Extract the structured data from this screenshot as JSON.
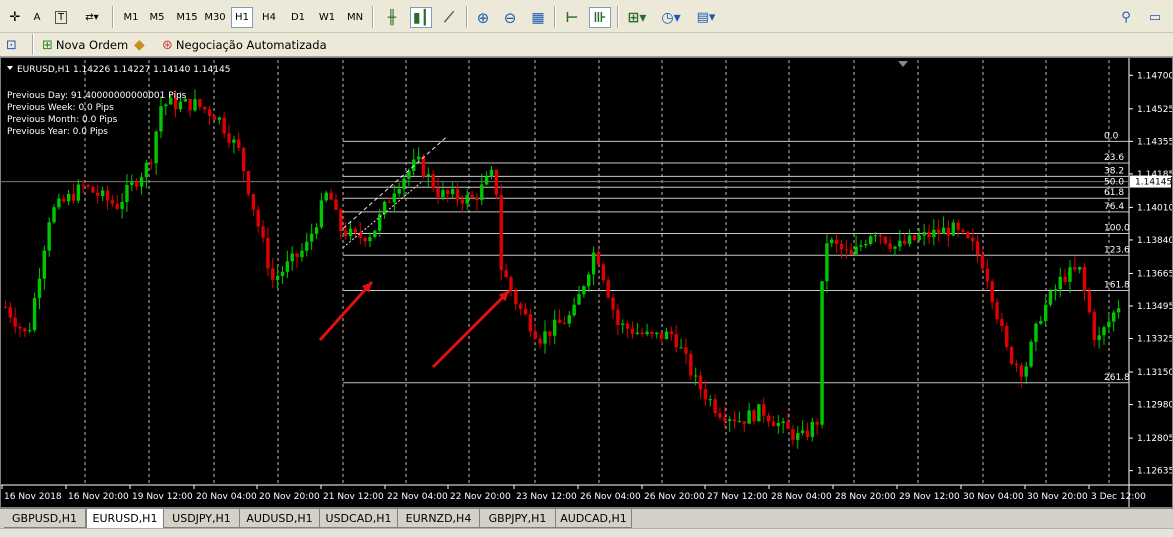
{
  "toolbar": {
    "timeframes": [
      "M1",
      "M5",
      "M15",
      "M30",
      "H1",
      "H4",
      "D1",
      "W1",
      "MN"
    ],
    "active_timeframe": "H1",
    "new_order_label": "Nova Ordem",
    "auto_trading_label": "Negociação Automatizada"
  },
  "chart": {
    "header": "EURUSD,H1  1.14226 1.14227 1.14140 1.14145",
    "info_lines": [
      "Previous Day: 91.40000000000001 Pips",
      "Previous Week: 0.0 Pips",
      "Previous Month: 0.0 Pips",
      "Previous Year: 0.0 Pips"
    ],
    "price_labels": [
      "1.14700",
      "1.14525",
      "1.14355",
      "1.14185",
      "1.14010",
      "1.13840",
      "1.13665",
      "1.13495",
      "1.13325",
      "1.13150",
      "1.12980",
      "1.12805",
      "1.12635"
    ],
    "current_price": "1.14145",
    "time_labels": [
      "16 Nov 2018",
      "16 Nov 20:00",
      "19 Nov 12:00",
      "20 Nov 04:00",
      "20 Nov 20:00",
      "21 Nov 12:00",
      "22 Nov 04:00",
      "22 Nov 20:00",
      "23 Nov 12:00",
      "26 Nov 04:00",
      "26 Nov 20:00",
      "27 Nov 12:00",
      "28 Nov 04:00",
      "28 Nov 20:00",
      "29 Nov 12:00",
      "30 Nov 04:00",
      "30 Nov 20:00",
      "3 Dec 12:00"
    ],
    "fibo_labels": [
      "0.0",
      "23.6",
      "38.2",
      "50.0",
      "61.8",
      "76.4",
      "100.0",
      "123.6",
      "161.8",
      "261.8"
    ],
    "colors": {
      "bull": "#00c800",
      "bear": "#e00000",
      "grid": "#ffffff",
      "text": "#ffffff",
      "arrow": "#e01010",
      "fibo": "#c8c8c8"
    }
  },
  "chart_data": {
    "type": "candlestick",
    "symbol": "EURUSD",
    "timeframe": "H1",
    "ylim": [
      1.1256,
      1.1478
    ],
    "fibonacci_levels": [
      {
        "label": "0.0",
        "price": 1.14355
      },
      {
        "label": "23.6",
        "price": 1.14242
      },
      {
        "label": "38.2",
        "price": 1.14172
      },
      {
        "label": "50.0",
        "price": 1.14115
      },
      {
        "label": "61.8",
        "price": 1.14058
      },
      {
        "label": "76.4",
        "price": 1.13987
      },
      {
        "label": "100.0",
        "price": 1.13874
      },
      {
        "label": "123.6",
        "price": 1.1376
      },
      {
        "label": "161.8",
        "price": 1.13576
      },
      {
        "label": "261.8",
        "price": 1.13094
      }
    ],
    "anchors": [
      {
        "x": 0.0,
        "y": 1.1349
      },
      {
        "x": 0.02,
        "y": 1.1333
      },
      {
        "x": 0.04,
        "y": 1.1398
      },
      {
        "x": 0.07,
        "y": 1.1412
      },
      {
        "x": 0.1,
        "y": 1.1402
      },
      {
        "x": 0.13,
        "y": 1.1425
      },
      {
        "x": 0.14,
        "y": 1.1455
      },
      {
        "x": 0.17,
        "y": 1.1455
      },
      {
        "x": 0.19,
        "y": 1.1449
      },
      {
        "x": 0.21,
        "y": 1.143
      },
      {
        "x": 0.23,
        "y": 1.1385
      },
      {
        "x": 0.24,
        "y": 1.1363
      },
      {
        "x": 0.27,
        "y": 1.138
      },
      {
        "x": 0.29,
        "y": 1.141
      },
      {
        "x": 0.3,
        "y": 1.139
      },
      {
        "x": 0.315,
        "y": 1.1385
      },
      {
        "x": 0.33,
        "y": 1.1388
      },
      {
        "x": 0.35,
        "y": 1.1412
      },
      {
        "x": 0.37,
        "y": 1.1425
      },
      {
        "x": 0.39,
        "y": 1.1408
      },
      {
        "x": 0.42,
        "y": 1.1405
      },
      {
        "x": 0.44,
        "y": 1.142
      },
      {
        "x": 0.445,
        "y": 1.137
      },
      {
        "x": 0.46,
        "y": 1.135
      },
      {
        "x": 0.48,
        "y": 1.1333
      },
      {
        "x": 0.51,
        "y": 1.1345
      },
      {
        "x": 0.53,
        "y": 1.138
      },
      {
        "x": 0.55,
        "y": 1.134
      },
      {
        "x": 0.58,
        "y": 1.1333
      },
      {
        "x": 0.6,
        "y": 1.1335
      },
      {
        "x": 0.62,
        "y": 1.131
      },
      {
        "x": 0.64,
        "y": 1.1295
      },
      {
        "x": 0.66,
        "y": 1.129
      },
      {
        "x": 0.68,
        "y": 1.1295
      },
      {
        "x": 0.7,
        "y": 1.1285
      },
      {
        "x": 0.715,
        "y": 1.128
      },
      {
        "x": 0.73,
        "y": 1.129
      },
      {
        "x": 0.735,
        "y": 1.1385
      },
      {
        "x": 0.76,
        "y": 1.1375
      },
      {
        "x": 0.78,
        "y": 1.139
      },
      {
        "x": 0.8,
        "y": 1.138
      },
      {
        "x": 0.82,
        "y": 1.1385
      },
      {
        "x": 0.85,
        "y": 1.139
      },
      {
        "x": 0.87,
        "y": 1.138
      },
      {
        "x": 0.88,
        "y": 1.137
      },
      {
        "x": 0.9,
        "y": 1.1325
      },
      {
        "x": 0.915,
        "y": 1.1315
      },
      {
        "x": 0.93,
        "y": 1.1345
      },
      {
        "x": 0.95,
        "y": 1.1365
      },
      {
        "x": 0.965,
        "y": 1.1368
      },
      {
        "x": 0.98,
        "y": 1.133
      },
      {
        "x": 1.0,
        "y": 1.135
      }
    ]
  }
}
